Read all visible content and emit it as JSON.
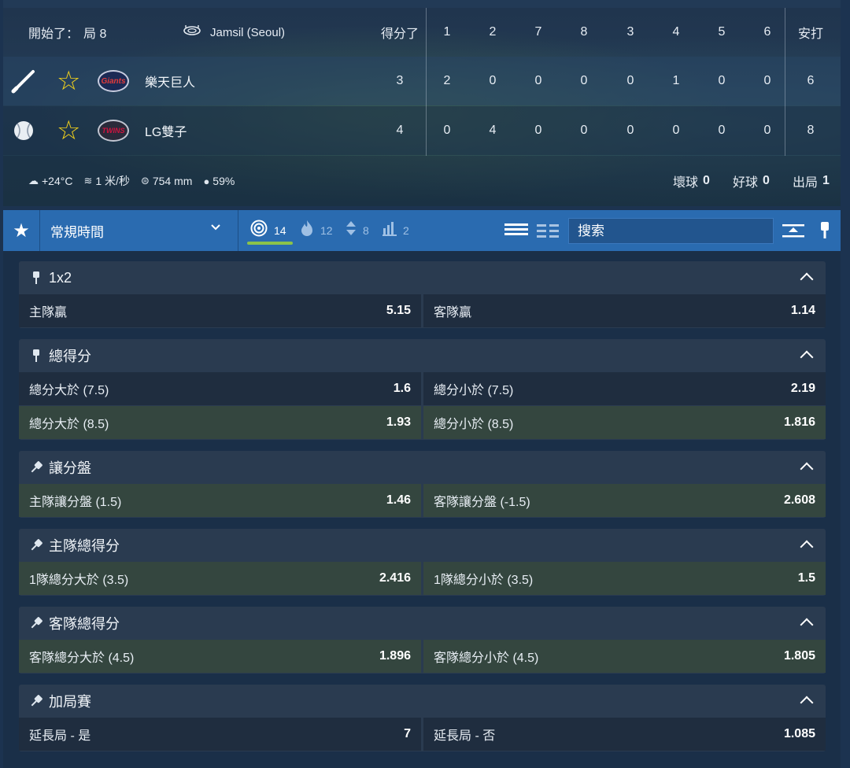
{
  "scoreboard": {
    "status_label": "開始了：",
    "inning": "局 8",
    "venue": "Jamsil (Seoul)",
    "runs_header": "得分了",
    "innings": [
      "1",
      "2",
      "7",
      "8",
      "3",
      "4",
      "5",
      "6"
    ],
    "hits_header": "安打",
    "teams": [
      {
        "name": "樂天巨人",
        "logo": "Giants",
        "runs": "3",
        "innings": [
          "2",
          "0",
          "0",
          "0",
          "0",
          "1",
          "0",
          "0"
        ],
        "hits": "6",
        "indicator": "bat-icon"
      },
      {
        "name": "LG雙子",
        "logo": "TWINS",
        "runs": "4",
        "innings": [
          "0",
          "4",
          "0",
          "0",
          "0",
          "0",
          "0",
          "0"
        ],
        "hits": "8",
        "indicator": "baseball-icon"
      }
    ],
    "weather": {
      "temperature": "+24°C",
      "wind": "1 米/秒",
      "pressure": "754 mm",
      "humidity": "59%"
    },
    "count": {
      "balls_label": "壞球",
      "balls": "0",
      "strikes_label": "好球",
      "strikes": "0",
      "outs_label": "出局",
      "outs": "1"
    }
  },
  "filterbar": {
    "period": "常規時間",
    "tabs": [
      {
        "icon": "target-icon",
        "count": "14"
      },
      {
        "icon": "fire-icon",
        "count": "12"
      },
      {
        "icon": "updown-icon",
        "count": "8"
      },
      {
        "icon": "stats-icon",
        "count": "2"
      }
    ],
    "search_placeholder": "搜索"
  },
  "markets": [
    {
      "title": "1x2",
      "pin": "pin-icon",
      "rows": [
        [
          {
            "label": "主隊贏",
            "value": "5.15"
          },
          {
            "label": "客隊贏",
            "value": "1.14"
          }
        ]
      ]
    },
    {
      "title": "總得分",
      "pin": "pin-icon",
      "rows": [
        [
          {
            "label": "總分大於 (7.5)",
            "value": "1.6"
          },
          {
            "label": "總分小於 (7.5)",
            "value": "2.19"
          }
        ],
        [
          {
            "label": "總分大於 (8.5)",
            "value": "1.93"
          },
          {
            "label": "總分小於 (8.5)",
            "value": "1.816"
          }
        ]
      ]
    },
    {
      "title": "讓分盤",
      "pin": "pin-tilt-icon",
      "rows": [
        [
          {
            "label": "主隊讓分盤 (1.5)",
            "value": "1.46"
          },
          {
            "label": "客隊讓分盤 (-1.5)",
            "value": "2.608"
          }
        ]
      ]
    },
    {
      "title": "主隊總得分",
      "pin": "pin-tilt-icon",
      "rows": [
        [
          {
            "label": "1隊總分大於 (3.5)",
            "value": "2.416"
          },
          {
            "label": "1隊總分小於 (3.5)",
            "value": "1.5"
          }
        ]
      ]
    },
    {
      "title": "客隊總得分",
      "pin": "pin-tilt-icon",
      "rows": [
        [
          {
            "label": "客隊總分大於 (4.5)",
            "value": "1.896"
          },
          {
            "label": "客隊總分小於 (4.5)",
            "value": "1.805"
          }
        ]
      ]
    },
    {
      "title": "加局賽",
      "pin": "pin-tilt-icon",
      "rows": [
        [
          {
            "label": "延長局 - 是",
            "value": "7"
          },
          {
            "label": "延長局 - 否",
            "value": "1.085"
          }
        ]
      ]
    }
  ],
  "colors": {
    "accent_blue": "#2a6bb0",
    "star_yellow": "#f3d21b",
    "active_underline": "#8bc34a",
    "odd_dark": "#1f2d3f",
    "odd_green": "#2e3f3d"
  }
}
